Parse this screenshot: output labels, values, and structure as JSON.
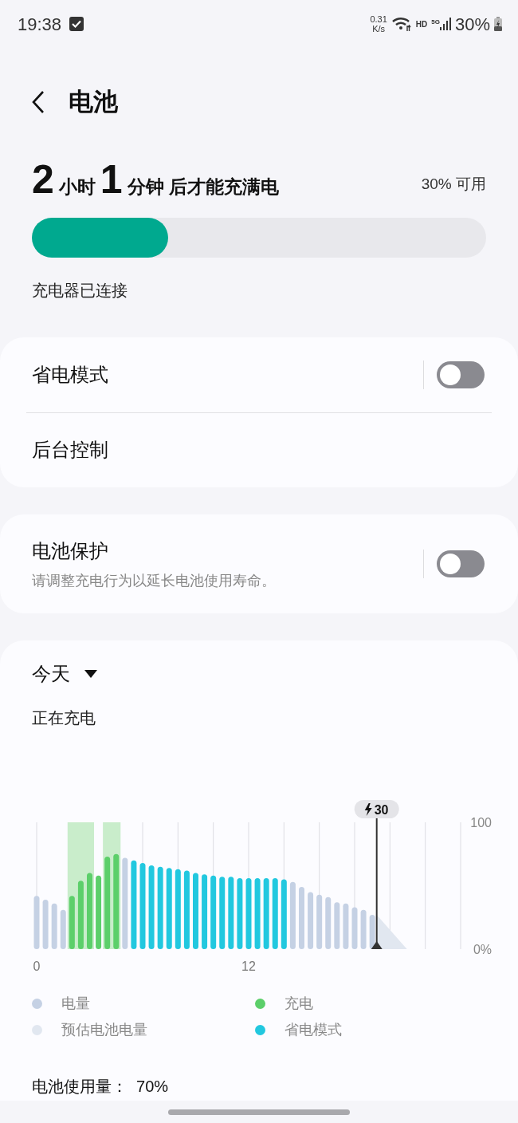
{
  "status_bar": {
    "time": "19:38",
    "net_speed": [
      "0.31",
      "K/s"
    ],
    "hd": "HD",
    "network": "5G",
    "battery": "30%"
  },
  "header": {
    "title": "电池"
  },
  "charge": {
    "parts": [
      {
        "kind": "number",
        "text": "2"
      },
      {
        "kind": "unit",
        "text": "小时"
      },
      {
        "kind": "number",
        "text": "1"
      },
      {
        "kind": "unit",
        "text": "分钟 后才能充满电"
      }
    ],
    "available": "30% 可用",
    "level": 0.3,
    "status": "充电器已连接"
  },
  "settings_group": [
    {
      "label": "省电模式",
      "kind": "toggle",
      "on": false
    },
    {
      "label": "后台控制",
      "kind": "link"
    }
  ],
  "protection": {
    "label": "电池保护",
    "description": "请调整充电行为以延长电池使用寿命。",
    "on": false
  },
  "usage": {
    "period": "今天",
    "status": "正在充电",
    "marker": "30",
    "chart_data": {
      "type": "bar",
      "x": [
        0,
        0.5,
        1,
        1.5,
        2,
        2.5,
        3,
        3.5,
        4,
        4.5,
        5,
        5.5,
        6,
        6.5,
        7,
        7.5,
        8,
        8.5,
        9,
        9.5,
        10,
        10.5,
        11,
        11.5,
        12,
        12.5,
        13,
        13.5,
        14,
        14.5,
        15,
        15.5,
        16,
        16.5,
        17,
        17.5,
        18,
        18.5,
        19
      ],
      "xlim": [
        0,
        24
      ],
      "ylim": [
        0,
        100
      ],
      "bands": [
        {
          "axis": "x",
          "from": 1.75,
          "to": 3.25
        },
        {
          "axis": "x",
          "from": 3.75,
          "to": 4.75
        }
      ],
      "ref_lines": [
        {
          "axis": "x",
          "value": 19.25
        }
      ],
      "xticks": [
        {
          "value": 0,
          "label": "0"
        },
        {
          "value": 12,
          "label": "12"
        }
      ],
      "yticks": [
        {
          "value": 0,
          "label": "0%"
        },
        {
          "value": 100,
          "label": "100"
        }
      ],
      "series": [
        {
          "name": "电量",
          "color": "#c5d1e4",
          "values": [
            42,
            39,
            36,
            31,
            null,
            null,
            null,
            null,
            null,
            null,
            72,
            null,
            null,
            null,
            null,
            null,
            null,
            null,
            null,
            null,
            null,
            null,
            null,
            null,
            null,
            null,
            null,
            null,
            null,
            53,
            49,
            45,
            43,
            41,
            37,
            36,
            33,
            31,
            27
          ]
        },
        {
          "name": "充电",
          "color": "#5ccf6a",
          "values": [
            null,
            null,
            null,
            null,
            42,
            54,
            60,
            58,
            73,
            75,
            null,
            null,
            null,
            null,
            null,
            null,
            null,
            null,
            null,
            null,
            null,
            null,
            null,
            null,
            null,
            null,
            null,
            null,
            null,
            null,
            null,
            null,
            null,
            null,
            null,
            null,
            null,
            null,
            null
          ]
        },
        {
          "name": "省电模式",
          "color": "#22c8df",
          "values": [
            null,
            null,
            null,
            null,
            null,
            null,
            null,
            null,
            null,
            null,
            null,
            70,
            68,
            66,
            65,
            64,
            63,
            62,
            60,
            59,
            58,
            57,
            57,
            56,
            56,
            56,
            56,
            56,
            55,
            null,
            null,
            null,
            null,
            null,
            null,
            null,
            null,
            null,
            null
          ]
        }
      ]
    },
    "estimate": {
      "label": "预估电池电量",
      "color": "#e1e7f0"
    },
    "usage_total": "电池使用量：  70%"
  }
}
